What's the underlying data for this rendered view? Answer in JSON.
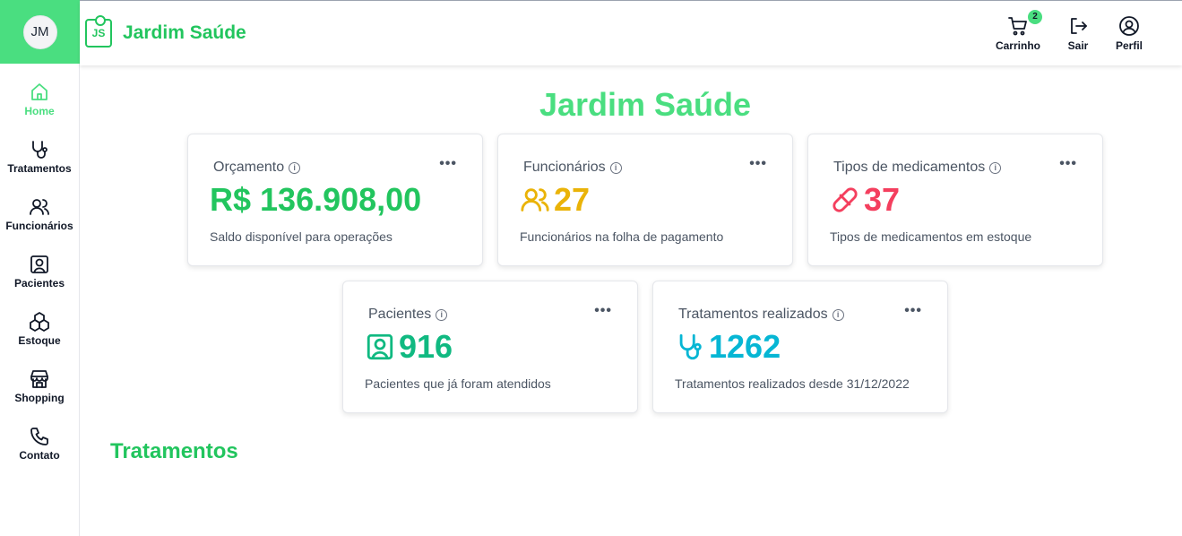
{
  "user": {
    "initials": "JM"
  },
  "brand": {
    "logo_text": "JS",
    "name": "Jardim Saúde"
  },
  "colors": {
    "accent": "#4ade80",
    "green": "#22c55e",
    "amber": "#eab308",
    "red": "#f43f5e",
    "teal": "#10b981",
    "cyan": "#06b6d4"
  },
  "sidebar": {
    "items": [
      {
        "label": "Home",
        "icon": "home-icon",
        "active": true
      },
      {
        "label": "Tratamentos",
        "icon": "stethoscope-icon"
      },
      {
        "label": "Funcionários",
        "icon": "users-icon"
      },
      {
        "label": "Pacientes",
        "icon": "patient-icon"
      },
      {
        "label": "Estoque",
        "icon": "boxes-icon"
      },
      {
        "label": "Shopping",
        "icon": "store-icon"
      },
      {
        "label": "Contato",
        "icon": "phone-icon"
      }
    ]
  },
  "header": {
    "cart": {
      "label": "Carrinho",
      "count": "2",
      "icon": "cart-icon"
    },
    "logout": {
      "label": "Sair",
      "icon": "logout-icon"
    },
    "profile": {
      "label": "Perfil",
      "icon": "user-circle-icon"
    }
  },
  "main": {
    "title": "Jardim Saúde",
    "cards": [
      {
        "title": "Orçamento",
        "value": "R$ 136.908,00",
        "desc": "Saldo disponível para operações"
      },
      {
        "title": "Funcionários",
        "value": "27",
        "desc": "Funcionários na folha de pagamento",
        "icon": "users-icon"
      },
      {
        "title": "Tipos de medicamentos",
        "value": "37",
        "desc": "Tipos de medicamentos em estoque",
        "icon": "pill-icon"
      },
      {
        "title": "Pacientes",
        "value": "916",
        "desc": "Pacientes que já foram atendidos",
        "icon": "patient-icon"
      },
      {
        "title": "Tratamentos realizados",
        "value": "1262",
        "desc": "Tratamentos realizados desde 31/12/2022",
        "icon": "stethoscope-icon"
      }
    ],
    "section_title": "Tratamentos"
  }
}
